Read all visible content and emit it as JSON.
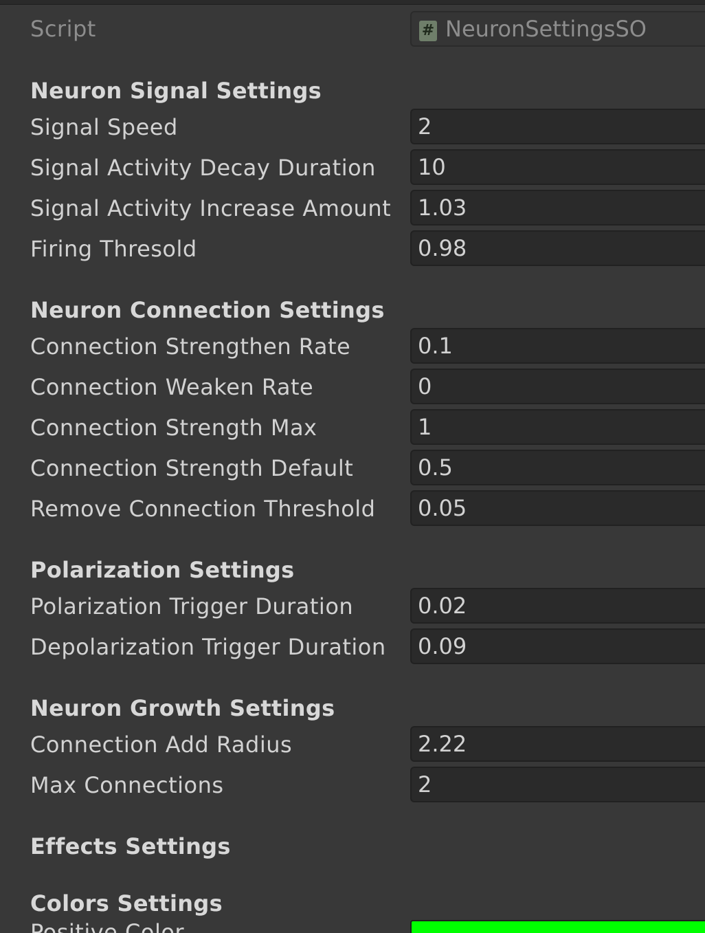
{
  "script": {
    "label": "Script",
    "value": "NeuronSettingsSO",
    "icon": "script-hash-icon"
  },
  "sections": {
    "signal": {
      "title": "Neuron Signal Settings",
      "fields": [
        {
          "label": "Signal Speed",
          "value": "2"
        },
        {
          "label": "Signal Activity Decay Duration",
          "value": "10"
        },
        {
          "label": "Signal Activity Increase Amount",
          "value": "1.03"
        },
        {
          "label": "Firing Thresold",
          "value": "0.98"
        }
      ]
    },
    "connection": {
      "title": "Neuron Connection Settings",
      "fields": [
        {
          "label": "Connection Strengthen Rate",
          "value": "0.1"
        },
        {
          "label": "Connection Weaken Rate",
          "value": "0"
        },
        {
          "label": "Connection Strength Max",
          "value": "1"
        },
        {
          "label": "Connection Strength Default",
          "value": "0.5"
        },
        {
          "label": "Remove Connection Threshold",
          "value": "0.05"
        }
      ]
    },
    "polarization": {
      "title": "Polarization Settings",
      "fields": [
        {
          "label": "Polarization Trigger Duration",
          "value": "0.02"
        },
        {
          "label": "Depolarization Trigger Duration",
          "value": "0.09"
        }
      ]
    },
    "growth": {
      "title": "Neuron Growth Settings",
      "fields": [
        {
          "label": "Connection Add Radius",
          "value": "2.22"
        },
        {
          "label": "Max Connections",
          "value": "2"
        }
      ]
    },
    "effects": {
      "title": "Effects Settings"
    },
    "colors": {
      "title": "Colors Settings",
      "fields": [
        {
          "label": "Positive Color",
          "color": "#00ff00"
        }
      ]
    }
  }
}
